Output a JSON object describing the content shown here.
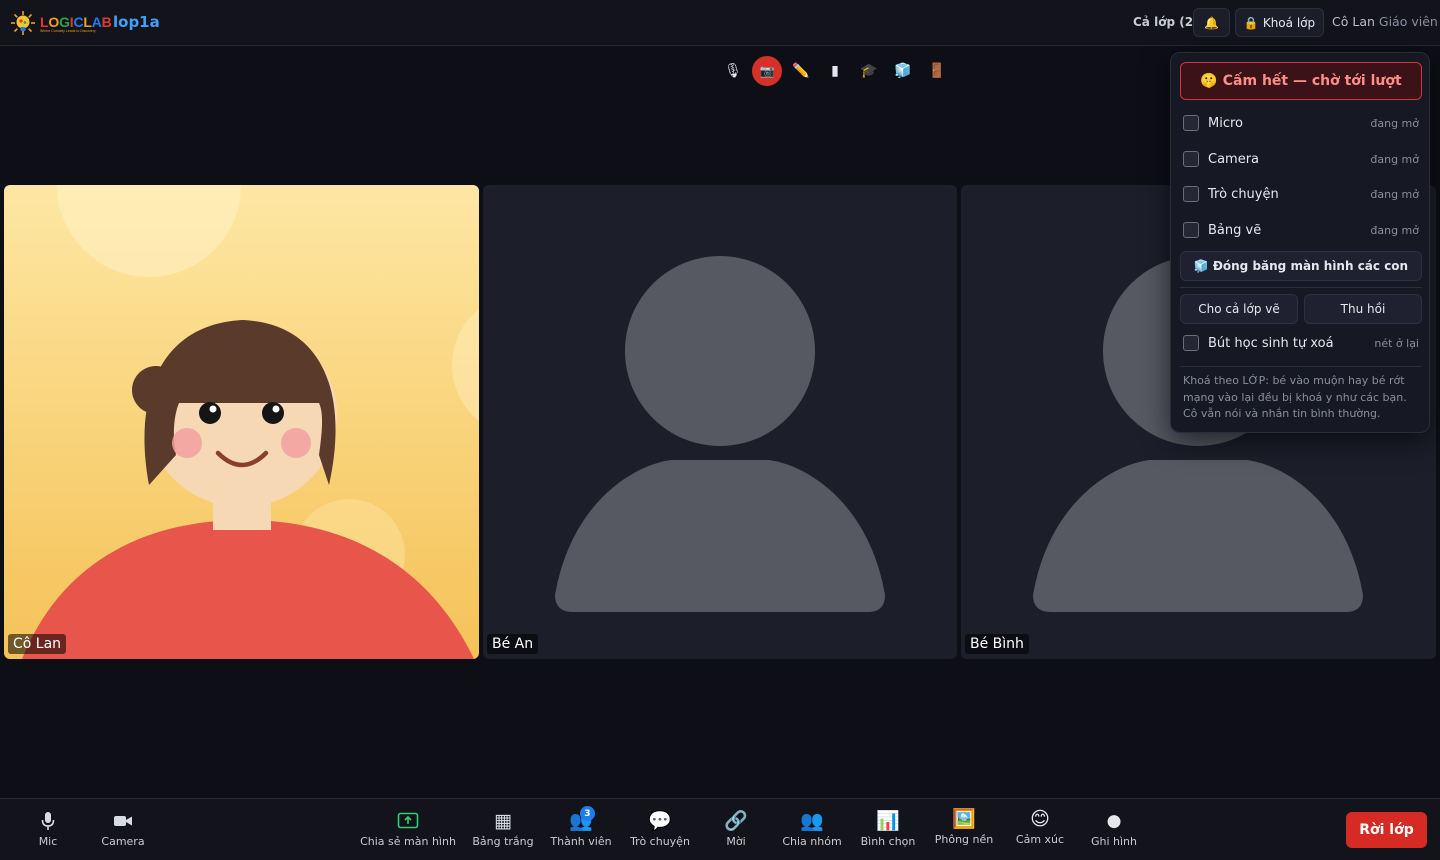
{
  "header": {
    "logo_text": [
      "L",
      "O",
      "G",
      "I",
      "C",
      "L",
      "A",
      "B"
    ],
    "logo_colors": [
      "#e2372c",
      "#f0a31a",
      "#2aa54a",
      "#e2372c",
      "#1e7cf2",
      "#f0a31a",
      "#1e7cf2",
      "#e2372c"
    ],
    "logo_tagline": "Where Curiosity Leads to Discovery",
    "room_name": "lop1a",
    "class_count": "Cả lớp (2)",
    "bell_icon": "🔔",
    "lock_icon": "🔒",
    "lock_label": "Khoá lớp",
    "user_name": "Cô Lan",
    "user_role": "Giáo viên"
  },
  "floating_tools": [
    {
      "name": "mic-icon",
      "glyph": "🎙",
      "active": false
    },
    {
      "name": "camera-off-icon",
      "glyph": "📷",
      "active": true
    },
    {
      "name": "pencil-icon",
      "glyph": "✏️",
      "active": false
    },
    {
      "name": "remote-icon",
      "glyph": "▮",
      "active": false
    },
    {
      "name": "graduation-cap-icon",
      "glyph": "🎓",
      "active": false
    },
    {
      "name": "ice-cube-icon",
      "glyph": "🧊",
      "active": false
    },
    {
      "name": "door-icon",
      "glyph": "🚪",
      "active": false
    }
  ],
  "tiles": [
    {
      "label": "Cô Lan",
      "type": "avatar"
    },
    {
      "label": "Bé An",
      "type": "placeholder"
    },
    {
      "label": "Bé Bình",
      "type": "placeholder"
    }
  ],
  "lock_panel": {
    "mute_all_icon": "🤫",
    "mute_all_label": "Cấm hết — chờ tới lượt",
    "rows": [
      {
        "label": "Micro",
        "status": "đang mở"
      },
      {
        "label": "Camera",
        "status": "đang mở"
      },
      {
        "label": "Trò chuyện",
        "status": "đang mở"
      },
      {
        "label": "Bảng vẽ",
        "status": "đang mở"
      }
    ],
    "freeze_icon": "🧊",
    "freeze_label": "Đóng băng màn hình các con",
    "allow_draw_label": "Cho cả lớp vẽ",
    "revoke_label": "Thu hồi",
    "auto_erase_label": "Bút học sinh tự xoá",
    "auto_erase_status": "nét ở lại",
    "note": "Khoá theo LỚP: bé vào muộn hay bé rớt mạng vào lại đều bị khoá y như các bạn. Cô vẫn nói và nhắn tin bình thường."
  },
  "bottombar": {
    "mic": {
      "label": "Mic",
      "icon": "🎙"
    },
    "camera": {
      "label": "Camera",
      "icon": "📹"
    },
    "share": {
      "label": "Chia sẻ màn hình",
      "icon": "⬆"
    },
    "whiteboard": {
      "label": "Bảng trắng",
      "icon": "▦"
    },
    "members": {
      "label": "Thành viên",
      "icon": "👥",
      "badge": "3"
    },
    "chat": {
      "label": "Trò chuyện",
      "icon": "💬"
    },
    "invite": {
      "label": "Mời",
      "icon": "🔗"
    },
    "breakout": {
      "label": "Chia nhóm",
      "icon": "👥"
    },
    "poll": {
      "label": "Bình chọn",
      "icon": "📊"
    },
    "background": {
      "label": "Phông nền",
      "icon": "🖼️"
    },
    "reactions": {
      "label": "Cảm xúc",
      "icon": "😊"
    },
    "record": {
      "label": "Ghi hình",
      "icon": "●"
    },
    "leave_label": "Rời lớp"
  },
  "colors": {
    "accent": "#3ea1ff",
    "danger": "#d62b24",
    "avatar_shirt": "#e8564b",
    "avatar_hair": "#5a3a2a",
    "avatar_skin": "#f7d8b5",
    "placeholder_figure": "#565862"
  }
}
